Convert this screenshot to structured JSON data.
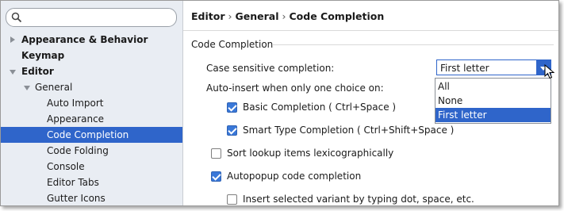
{
  "search": {
    "placeholder": ""
  },
  "sidebar": {
    "items": [
      {
        "label": "Appearance & Behavior"
      },
      {
        "label": "Keymap"
      },
      {
        "label": "Editor"
      },
      {
        "label": "General"
      },
      {
        "label": "Auto Import"
      },
      {
        "label": "Appearance"
      },
      {
        "label": "Code Completion"
      },
      {
        "label": "Code Folding"
      },
      {
        "label": "Console"
      },
      {
        "label": "Editor Tabs"
      },
      {
        "label": "Gutter Icons"
      }
    ]
  },
  "breadcrumb": {
    "part1": "Editor",
    "part2": "General",
    "part3": "Code Completion",
    "sep": "›"
  },
  "section": {
    "title": "Code Completion"
  },
  "case_sensitive": {
    "label": "Case sensitive completion:",
    "selected": "First letter",
    "options": [
      "All",
      "None",
      "First letter"
    ]
  },
  "auto_insert": {
    "label": "Auto-insert when only one choice on:"
  },
  "basic_completion": {
    "label": "Basic Completion ( Ctrl+Space )",
    "checked": true
  },
  "smart_completion": {
    "label": "Smart Type Completion ( Ctrl+Shift+Space )",
    "checked": true
  },
  "sort_lookup": {
    "label": "Sort lookup items lexicographically",
    "checked": false
  },
  "autopopup": {
    "label": "Autopopup code completion",
    "checked": true
  },
  "insert_variant": {
    "label": "Insert selected variant by typing dot, space, etc.",
    "checked": false
  },
  "colors": {
    "selection": "#2f65ca",
    "sidebar_bg": "#e9edf3",
    "checkbox_checked": "#3a78d8"
  }
}
